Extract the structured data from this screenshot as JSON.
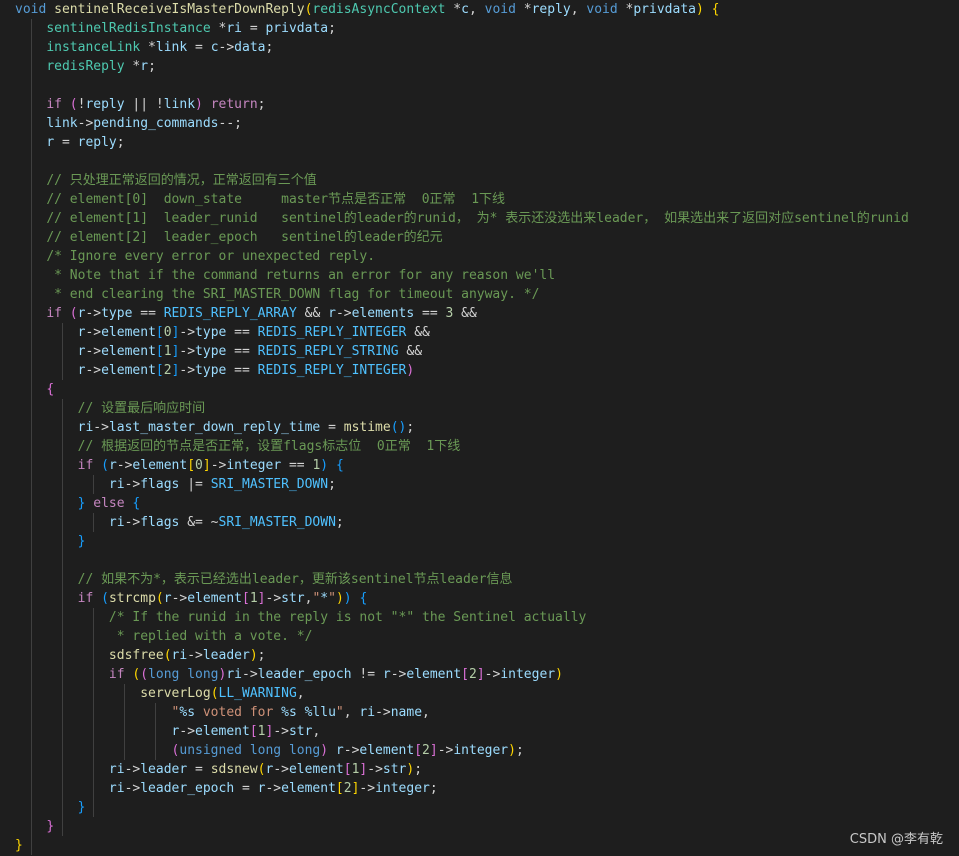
{
  "editor": {
    "background": "#1e1e1e",
    "colors": {
      "keyword": "#569cd6",
      "control": "#c586c0",
      "type": "#4ec9b0",
      "function": "#dcdcaa",
      "variable": "#9cdcfe",
      "comment": "#6a9955",
      "number": "#b5cea8",
      "string": "#ce9178",
      "macro": "#4fc1ff",
      "bracket1": "#ffd700",
      "bracket2": "#da70d6",
      "bracket3": "#179fff"
    },
    "lines": [
      [
        [
          "kw",
          "void"
        ],
        [
          "op",
          " "
        ],
        [
          "fn",
          "sentinelReceiveIsMasterDownReply"
        ],
        [
          "b1",
          "("
        ],
        [
          "ty",
          "redisAsyncContext"
        ],
        [
          "op",
          " *"
        ],
        [
          "var",
          "c"
        ],
        [
          "op",
          ", "
        ],
        [
          "kw",
          "void"
        ],
        [
          "op",
          " *"
        ],
        [
          "var",
          "reply"
        ],
        [
          "op",
          ", "
        ],
        [
          "kw",
          "void"
        ],
        [
          "op",
          " *"
        ],
        [
          "var",
          "privdata"
        ],
        [
          "b1",
          ")"
        ],
        [
          "op",
          " "
        ],
        [
          "b1",
          "{"
        ]
      ],
      [
        [
          "op",
          "    "
        ],
        [
          "ty",
          "sentinelRedisInstance"
        ],
        [
          "op",
          " *"
        ],
        [
          "var",
          "ri"
        ],
        [
          "op",
          " = "
        ],
        [
          "var",
          "privdata"
        ],
        [
          "op",
          ";"
        ]
      ],
      [
        [
          "op",
          "    "
        ],
        [
          "ty",
          "instanceLink"
        ],
        [
          "op",
          " *"
        ],
        [
          "var",
          "link"
        ],
        [
          "op",
          " = "
        ],
        [
          "var",
          "c"
        ],
        [
          "op",
          "->"
        ],
        [
          "var",
          "data"
        ],
        [
          "op",
          ";"
        ]
      ],
      [
        [
          "op",
          "    "
        ],
        [
          "ty",
          "redisReply"
        ],
        [
          "op",
          " *"
        ],
        [
          "var",
          "r"
        ],
        [
          "op",
          ";"
        ]
      ],
      [],
      [
        [
          "op",
          "    "
        ],
        [
          "ctl",
          "if"
        ],
        [
          "op",
          " "
        ],
        [
          "b2",
          "("
        ],
        [
          "op",
          "!"
        ],
        [
          "var",
          "reply"
        ],
        [
          "op",
          " || !"
        ],
        [
          "var",
          "link"
        ],
        [
          "b2",
          ")"
        ],
        [
          "op",
          " "
        ],
        [
          "ctl",
          "return"
        ],
        [
          "op",
          ";"
        ]
      ],
      [
        [
          "op",
          "    "
        ],
        [
          "var",
          "link"
        ],
        [
          "op",
          "->"
        ],
        [
          "var",
          "pending_commands"
        ],
        [
          "op",
          "--;"
        ]
      ],
      [
        [
          "op",
          "    "
        ],
        [
          "var",
          "r"
        ],
        [
          "op",
          " = "
        ],
        [
          "var",
          "reply"
        ],
        [
          "op",
          ";"
        ]
      ],
      [],
      [
        [
          "op",
          "    "
        ],
        [
          "cmt",
          "// 只处理正常返回的情况，正常返回有三个值"
        ]
      ],
      [
        [
          "op",
          "    "
        ],
        [
          "cmt",
          "// element[0]  down_state     master节点是否正常  0正常  1下线"
        ]
      ],
      [
        [
          "op",
          "    "
        ],
        [
          "cmt",
          "// element[1]  leader_runid   sentinel的leader的runid， 为* 表示还没选出来leader， 如果选出来了返回对应sentinel的runid"
        ]
      ],
      [
        [
          "op",
          "    "
        ],
        [
          "cmt",
          "// element[2]  leader_epoch   sentinel的leader的纪元"
        ]
      ],
      [
        [
          "op",
          "    "
        ],
        [
          "cmt",
          "/* Ignore every error or unexpected reply."
        ]
      ],
      [
        [
          "op",
          "    "
        ],
        [
          "cmt",
          " * Note that if the command returns an error for any reason we'll"
        ]
      ],
      [
        [
          "op",
          "    "
        ],
        [
          "cmt",
          " * end clearing the SRI_MASTER_DOWN flag for timeout anyway. */"
        ]
      ],
      [
        [
          "op",
          "    "
        ],
        [
          "ctl",
          "if"
        ],
        [
          "op",
          " "
        ],
        [
          "b2",
          "("
        ],
        [
          "var",
          "r"
        ],
        [
          "op",
          "->"
        ],
        [
          "var",
          "type"
        ],
        [
          "op",
          " == "
        ],
        [
          "mac",
          "REDIS_REPLY_ARRAY"
        ],
        [
          "op",
          " && "
        ],
        [
          "var",
          "r"
        ],
        [
          "op",
          "->"
        ],
        [
          "var",
          "elements"
        ],
        [
          "op",
          " == "
        ],
        [
          "num",
          "3"
        ],
        [
          "op",
          " &&"
        ]
      ],
      [
        [
          "op",
          "        "
        ],
        [
          "var",
          "r"
        ],
        [
          "op",
          "->"
        ],
        [
          "var",
          "element"
        ],
        [
          "b3",
          "["
        ],
        [
          "num",
          "0"
        ],
        [
          "b3",
          "]"
        ],
        [
          "op",
          "->"
        ],
        [
          "var",
          "type"
        ],
        [
          "op",
          " == "
        ],
        [
          "mac",
          "REDIS_REPLY_INTEGER"
        ],
        [
          "op",
          " &&"
        ]
      ],
      [
        [
          "op",
          "        "
        ],
        [
          "var",
          "r"
        ],
        [
          "op",
          "->"
        ],
        [
          "var",
          "element"
        ],
        [
          "b3",
          "["
        ],
        [
          "num",
          "1"
        ],
        [
          "b3",
          "]"
        ],
        [
          "op",
          "->"
        ],
        [
          "var",
          "type"
        ],
        [
          "op",
          " == "
        ],
        [
          "mac",
          "REDIS_REPLY_STRING"
        ],
        [
          "op",
          " &&"
        ]
      ],
      [
        [
          "op",
          "        "
        ],
        [
          "var",
          "r"
        ],
        [
          "op",
          "->"
        ],
        [
          "var",
          "element"
        ],
        [
          "b3",
          "["
        ],
        [
          "num",
          "2"
        ],
        [
          "b3",
          "]"
        ],
        [
          "op",
          "->"
        ],
        [
          "var",
          "type"
        ],
        [
          "op",
          " == "
        ],
        [
          "mac",
          "REDIS_REPLY_INTEGER"
        ],
        [
          "b2",
          ")"
        ]
      ],
      [
        [
          "op",
          "    "
        ],
        [
          "b2",
          "{"
        ]
      ],
      [
        [
          "op",
          "        "
        ],
        [
          "cmt",
          "// 设置最后响应时间"
        ]
      ],
      [
        [
          "op",
          "        "
        ],
        [
          "var",
          "ri"
        ],
        [
          "op",
          "->"
        ],
        [
          "var",
          "last_master_down_reply_time"
        ],
        [
          "op",
          " = "
        ],
        [
          "fn",
          "mstime"
        ],
        [
          "b3",
          "()"
        ],
        [
          "op",
          ";"
        ]
      ],
      [
        [
          "op",
          "        "
        ],
        [
          "cmt",
          "// 根据返回的节点是否正常，设置flags标志位  0正常  1下线"
        ]
      ],
      [
        [
          "op",
          "        "
        ],
        [
          "ctl",
          "if"
        ],
        [
          "op",
          " "
        ],
        [
          "b3",
          "("
        ],
        [
          "var",
          "r"
        ],
        [
          "op",
          "->"
        ],
        [
          "var",
          "element"
        ],
        [
          "b1",
          "["
        ],
        [
          "num",
          "0"
        ],
        [
          "b1",
          "]"
        ],
        [
          "op",
          "->"
        ],
        [
          "var",
          "integer"
        ],
        [
          "op",
          " == "
        ],
        [
          "num",
          "1"
        ],
        [
          "b3",
          ")"
        ],
        [
          "op",
          " "
        ],
        [
          "b3",
          "{"
        ]
      ],
      [
        [
          "op",
          "            "
        ],
        [
          "var",
          "ri"
        ],
        [
          "op",
          "->"
        ],
        [
          "var",
          "flags"
        ],
        [
          "op",
          " |= "
        ],
        [
          "mac",
          "SRI_MASTER_DOWN"
        ],
        [
          "op",
          ";"
        ]
      ],
      [
        [
          "op",
          "        "
        ],
        [
          "b3",
          "}"
        ],
        [
          "op",
          " "
        ],
        [
          "ctl",
          "else"
        ],
        [
          "op",
          " "
        ],
        [
          "b3",
          "{"
        ]
      ],
      [
        [
          "op",
          "            "
        ],
        [
          "var",
          "ri"
        ],
        [
          "op",
          "->"
        ],
        [
          "var",
          "flags"
        ],
        [
          "op",
          " &= ~"
        ],
        [
          "mac",
          "SRI_MASTER_DOWN"
        ],
        [
          "op",
          ";"
        ]
      ],
      [
        [
          "op",
          "        "
        ],
        [
          "b3",
          "}"
        ]
      ],
      [],
      [
        [
          "op",
          "        "
        ],
        [
          "cmt",
          "// 如果不为*，表示已经选出leader，更新该sentinel节点leader信息"
        ]
      ],
      [
        [
          "op",
          "        "
        ],
        [
          "ctl",
          "if"
        ],
        [
          "op",
          " "
        ],
        [
          "b3",
          "("
        ],
        [
          "fn",
          "strcmp"
        ],
        [
          "b1",
          "("
        ],
        [
          "var",
          "r"
        ],
        [
          "op",
          "->"
        ],
        [
          "var",
          "element"
        ],
        [
          "b2",
          "["
        ],
        [
          "num",
          "1"
        ],
        [
          "b2",
          "]"
        ],
        [
          "op",
          "->"
        ],
        [
          "var",
          "str"
        ],
        [
          "op",
          ","
        ],
        [
          "str",
          "\""
        ],
        [
          "esc",
          "*"
        ],
        [
          "str",
          "\""
        ],
        [
          "b1",
          ")"
        ],
        [
          "b3",
          ")"
        ],
        [
          "op",
          " "
        ],
        [
          "b3",
          "{"
        ]
      ],
      [
        [
          "op",
          "            "
        ],
        [
          "cmt",
          "/* If the runid in the reply is not \"*\" the Sentinel actually"
        ]
      ],
      [
        [
          "op",
          "            "
        ],
        [
          "cmt",
          " * replied with a vote. */"
        ]
      ],
      [
        [
          "op",
          "            "
        ],
        [
          "fn",
          "sdsfree"
        ],
        [
          "b1",
          "("
        ],
        [
          "var",
          "ri"
        ],
        [
          "op",
          "->"
        ],
        [
          "var",
          "leader"
        ],
        [
          "b1",
          ")"
        ],
        [
          "op",
          ";"
        ]
      ],
      [
        [
          "op",
          "            "
        ],
        [
          "ctl",
          "if"
        ],
        [
          "op",
          " "
        ],
        [
          "b1",
          "("
        ],
        [
          "b2",
          "("
        ],
        [
          "kw",
          "long long"
        ],
        [
          "b2",
          ")"
        ],
        [
          "var",
          "ri"
        ],
        [
          "op",
          "->"
        ],
        [
          "var",
          "leader_epoch"
        ],
        [
          "op",
          " != "
        ],
        [
          "var",
          "r"
        ],
        [
          "op",
          "->"
        ],
        [
          "var",
          "element"
        ],
        [
          "b2",
          "["
        ],
        [
          "num",
          "2"
        ],
        [
          "b2",
          "]"
        ],
        [
          "op",
          "->"
        ],
        [
          "var",
          "integer"
        ],
        [
          "b1",
          ")"
        ]
      ],
      [
        [
          "op",
          "                "
        ],
        [
          "fn",
          "serverLog"
        ],
        [
          "b1",
          "("
        ],
        [
          "mac",
          "LL_WARNING"
        ],
        [
          "op",
          ","
        ]
      ],
      [
        [
          "op",
          "                    "
        ],
        [
          "str",
          "\""
        ],
        [
          "esc",
          "%s"
        ],
        [
          "str",
          " voted for "
        ],
        [
          "esc",
          "%s"
        ],
        [
          "str",
          " "
        ],
        [
          "esc",
          "%llu"
        ],
        [
          "str",
          "\""
        ],
        [
          "op",
          ", "
        ],
        [
          "var",
          "ri"
        ],
        [
          "op",
          "->"
        ],
        [
          "var",
          "name"
        ],
        [
          "op",
          ","
        ]
      ],
      [
        [
          "op",
          "                    "
        ],
        [
          "var",
          "r"
        ],
        [
          "op",
          "->"
        ],
        [
          "var",
          "element"
        ],
        [
          "b2",
          "["
        ],
        [
          "num",
          "1"
        ],
        [
          "b2",
          "]"
        ],
        [
          "op",
          "->"
        ],
        [
          "var",
          "str"
        ],
        [
          "op",
          ","
        ]
      ],
      [
        [
          "op",
          "                    "
        ],
        [
          "b2",
          "("
        ],
        [
          "kw",
          "unsigned long long"
        ],
        [
          "b2",
          ")"
        ],
        [
          "op",
          " "
        ],
        [
          "var",
          "r"
        ],
        [
          "op",
          "->"
        ],
        [
          "var",
          "element"
        ],
        [
          "b2",
          "["
        ],
        [
          "num",
          "2"
        ],
        [
          "b2",
          "]"
        ],
        [
          "op",
          "->"
        ],
        [
          "var",
          "integer"
        ],
        [
          "b1",
          ")"
        ],
        [
          "op",
          ";"
        ]
      ],
      [
        [
          "op",
          "            "
        ],
        [
          "var",
          "ri"
        ],
        [
          "op",
          "->"
        ],
        [
          "var",
          "leader"
        ],
        [
          "op",
          " = "
        ],
        [
          "fn",
          "sdsnew"
        ],
        [
          "b1",
          "("
        ],
        [
          "var",
          "r"
        ],
        [
          "op",
          "->"
        ],
        [
          "var",
          "element"
        ],
        [
          "b2",
          "["
        ],
        [
          "num",
          "1"
        ],
        [
          "b2",
          "]"
        ],
        [
          "op",
          "->"
        ],
        [
          "var",
          "str"
        ],
        [
          "b1",
          ")"
        ],
        [
          "op",
          ";"
        ]
      ],
      [
        [
          "op",
          "            "
        ],
        [
          "var",
          "ri"
        ],
        [
          "op",
          "->"
        ],
        [
          "var",
          "leader_epoch"
        ],
        [
          "op",
          " = "
        ],
        [
          "var",
          "r"
        ],
        [
          "op",
          "->"
        ],
        [
          "var",
          "element"
        ],
        [
          "b1",
          "["
        ],
        [
          "num",
          "2"
        ],
        [
          "b1",
          "]"
        ],
        [
          "op",
          "->"
        ],
        [
          "var",
          "integer"
        ],
        [
          "op",
          ";"
        ]
      ],
      [
        [
          "op",
          "        "
        ],
        [
          "b3",
          "}"
        ]
      ],
      [
        [
          "op",
          "    "
        ],
        [
          "b2",
          "}"
        ]
      ],
      [
        [
          "b1",
          "}"
        ]
      ]
    ]
  },
  "watermark": "CSDN @李有乾"
}
